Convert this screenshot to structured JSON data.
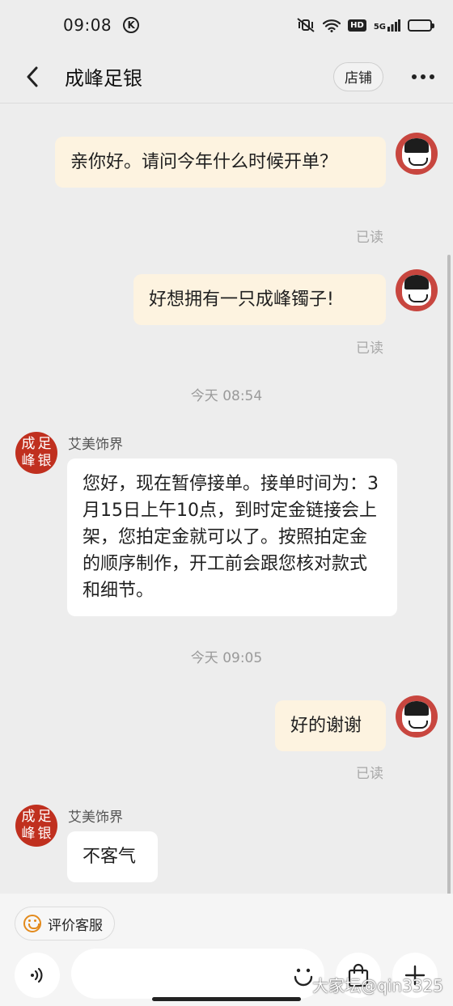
{
  "status_bar": {
    "time": "09:08",
    "k_icon": "K",
    "hd": "HD",
    "signal": "5G"
  },
  "header": {
    "title": "成峰足银",
    "shop_label": "店铺"
  },
  "messages": [
    {
      "side": "out",
      "text": "亲你好。请问今年什么时候开单？",
      "status": "已读"
    },
    {
      "side": "out",
      "text": "好想拥有一只成峰镯子!",
      "status": "已读"
    },
    {
      "side": "in",
      "sender": "艾美饰界",
      "text": "您好，现在暂停接单。接单时间为：3月15日上午10点，到时定金链接会上架，您拍定金就可以了。按照拍定金的顺序制作，开工前会跟您核对款式和细节。"
    },
    {
      "side": "out",
      "text": "好的谢谢",
      "status": "已读"
    },
    {
      "side": "in",
      "sender": "艾美饰界",
      "text": "不客气"
    }
  ],
  "time_separators": [
    "今天  08:54",
    "今天  09:05"
  ],
  "shop_avatar_chars": [
    "成",
    "足",
    "峰",
    "银"
  ],
  "bottom": {
    "rate_label": "评价客服",
    "watermark": "大家坛@qin3325"
  },
  "colors": {
    "outgoing_bubble": "#fdf3e0",
    "incoming_bubble": "#ffffff",
    "shop_avatar": "#c0301f",
    "accent": "#e38a1c"
  }
}
